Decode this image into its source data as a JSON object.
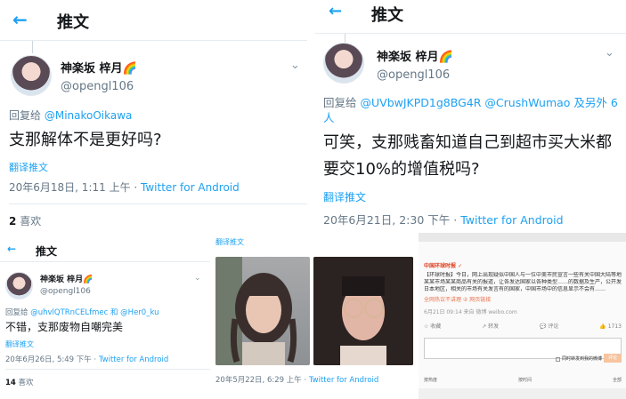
{
  "p1": {
    "header": "推文",
    "display_name": "神楽坂 梓月🌈",
    "handle": "@opengl106",
    "reply_label": "回复给",
    "reply_to": "@MinakoOikawa",
    "text": "支那解体不是更好吗?",
    "translate": "翻译推文",
    "meta_time": "20年6月18日, 1:11 上午 · ",
    "meta_source": "Twitter for Android",
    "likes_count": "2",
    "likes_label": "喜欢"
  },
  "p2": {
    "header": "推文",
    "display_name": "神楽坂 梓月🌈",
    "handle": "@opengl106",
    "reply_label": "回复给",
    "reply_to": "@UVbwJKPD1g8BG4R @CrushWumao 及另外 6 人",
    "text": "可笑，支那贱畜知道自己到超市买大米都要交10%的增值税吗?",
    "translate": "翻译推文",
    "meta_time": "20年6月21日, 2:30 下午 · ",
    "meta_source": "Twitter for Android"
  },
  "p3": {
    "header": "推文",
    "display_name": "神楽坂 梓月🌈",
    "handle": "@opengl106",
    "reply_label": "回复给",
    "reply_to": "@uhvlQTRnCELfmec 和 @Her0_ku",
    "text": "不错，支那废物自嘲完美",
    "translate": "翻译推文",
    "meta_time": "20年6月26日, 5:49 下午 · ",
    "meta_source": "Twitter for Android",
    "likes_count": "14",
    "likes_label": "喜欢"
  },
  "p4": {
    "translate": "翻译推文",
    "meta_time": "20年5月22日, 6:29 上午 · ",
    "meta_source": "Twitter for Android"
  },
  "p5": {
    "source_tag": "中国环球时报 ✓",
    "body_lines": [
      "【环球时报】今日，网上出现疑似中国人与一位中美市民宣言一些有关中国大陆等地的消息，原地点为",
      "某某市场某某商品有关的报道，让各发达国家以各种类型……的数据及生产，公开发表的相关文章表示",
      "日本地区，相关的市场有关发言有的国家，中国市场中的信息显示不会有……"
    ],
    "link_text": "全网热议不讲理 ② 网页链接",
    "sub": "6月21日 09:14 来自 微博 weibo.com",
    "stats": [
      "☆ 收藏",
      "↗ 转发",
      "💬 评论",
      "👍 1713"
    ],
    "check_text": "同时转发到我的微博",
    "reply_btn": "评论",
    "bottom_left": "按热度",
    "bottom_mid": "按时间",
    "bottom_right": "全部"
  }
}
